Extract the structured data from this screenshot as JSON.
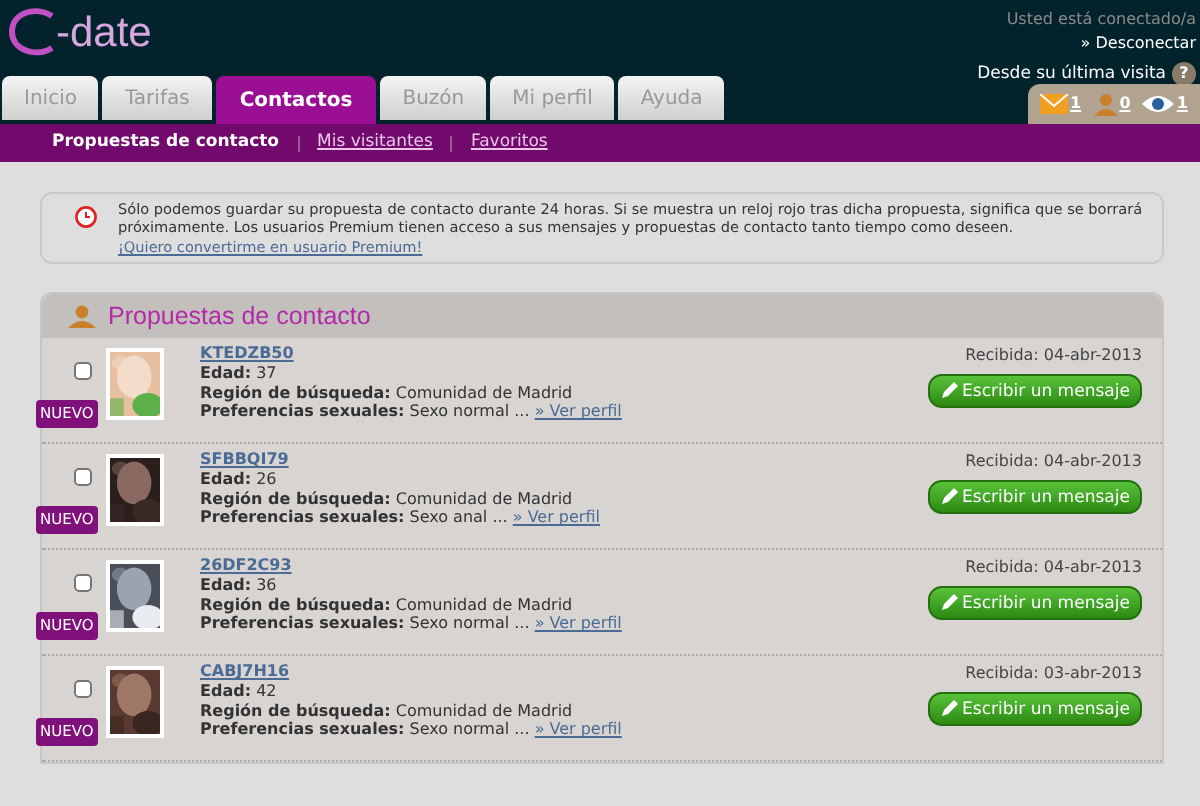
{
  "header": {
    "logo": "-date",
    "status": "Usted está conectado/a",
    "logout": "» Desconectar",
    "last_visit": "Desde su última visita",
    "help": "?",
    "counters": [
      {
        "kind": "mail",
        "count": "1"
      },
      {
        "kind": "person",
        "count": "0"
      },
      {
        "kind": "eye",
        "count": "1"
      }
    ]
  },
  "tabs": [
    {
      "label": "Inicio",
      "selected": false
    },
    {
      "label": "Tarifas",
      "selected": false
    },
    {
      "label": "Contactos",
      "selected": true
    },
    {
      "label": "Buzón",
      "selected": false
    },
    {
      "label": "Mi perfil",
      "selected": false
    },
    {
      "label": "Ayuda",
      "selected": false
    }
  ],
  "subnav": [
    {
      "label": "Propuestas de contacto",
      "selected": true
    },
    {
      "label": "Mis visitantes",
      "selected": false
    },
    {
      "label": "Favoritos",
      "selected": false
    }
  ],
  "notice": {
    "text": "Sólo podemos guardar su propuesta de contacto durante 24 horas. Si se muestra un reloj rojo tras dicha propuesta, significa que se borrará próximamente. Los usuarios Premium tienen acceso a sus mensajes y propuestas de contacto tanto tiempo como deseen.",
    "link": "¡Quiero convertirme en usuario Premium!"
  },
  "panel": {
    "title": "Propuestas de contacto",
    "rows": [
      {
        "name": "KTEDZB50",
        "age_label": "Edad:",
        "age": "37",
        "region_label": "Región de búsqueda:",
        "region": "Comunidad de Madrid",
        "prefs_label": "Preferencias sexuales:",
        "prefs": "Sexo normal ...",
        "profile_link": "» Ver perfil",
        "received": "Recibida: 04-abr-2013",
        "button": "Escribir un mensaje",
        "badge": "NUEVO",
        "checked": false
      },
      {
        "name": "SFBBQI79",
        "age_label": "Edad:",
        "age": "26",
        "region_label": "Región de búsqueda:",
        "region": "Comunidad de Madrid",
        "prefs_label": "Preferencias sexuales:",
        "prefs": "Sexo anal ...",
        "profile_link": "» Ver perfil",
        "received": "Recibida: 04-abr-2013",
        "button": "Escribir un mensaje",
        "badge": "NUEVO",
        "checked": false
      },
      {
        "name": "26DF2C93",
        "age_label": "Edad:",
        "age": "36",
        "region_label": "Región de búsqueda:",
        "region": "Comunidad de Madrid",
        "prefs_label": "Preferencias sexuales:",
        "prefs": "Sexo normal ...",
        "profile_link": "» Ver perfil",
        "received": "Recibida: 04-abr-2013",
        "button": "Escribir un mensaje",
        "badge": "NUEVO",
        "checked": false
      },
      {
        "name": "CABJ7H16",
        "age_label": "Edad:",
        "age": "42",
        "region_label": "Región de búsqueda:",
        "region": "Comunidad de Madrid",
        "prefs_label": "Preferencias sexuales:",
        "prefs": "Sexo normal ...",
        "profile_link": "» Ver perfil",
        "received": "Recibida: 03-abr-2013",
        "button": "Escribir un mensaje",
        "badge": "NUEVO",
        "checked": false
      }
    ]
  }
}
